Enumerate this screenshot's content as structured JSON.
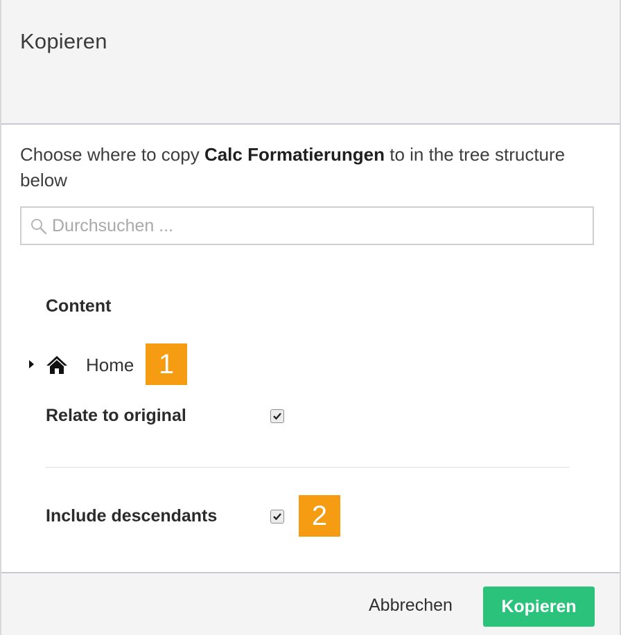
{
  "dialog": {
    "title": "Kopieren",
    "intro_prefix": "Choose where to copy ",
    "intro_item": "Calc Formatierungen",
    "intro_suffix": " to in the tree structure below"
  },
  "search": {
    "placeholder": "Durchsuchen ...",
    "value": ""
  },
  "tree": {
    "heading": "Content",
    "nodes": [
      {
        "label": "Home",
        "icon": "home-icon",
        "expandable": true
      }
    ]
  },
  "options": {
    "relate_label": "Relate to original",
    "relate_checked": true,
    "descendants_label": "Include descendants",
    "descendants_checked": true
  },
  "badges": {
    "first": "1",
    "second": "2"
  },
  "footer": {
    "cancel_label": "Abbrechen",
    "submit_label": "Kopieren"
  },
  "colors": {
    "primary_button": "#2bc37c",
    "badge": "#f59c13",
    "header_bg": "#f4f4f4"
  }
}
